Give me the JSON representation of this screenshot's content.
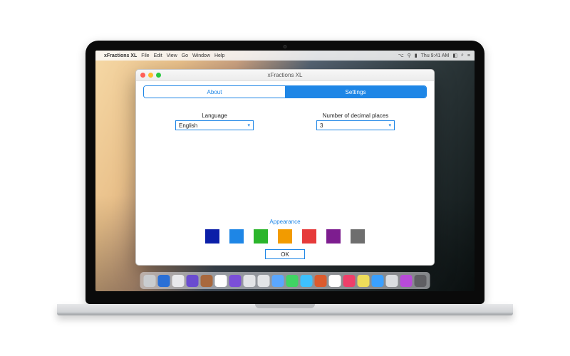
{
  "menubar": {
    "apple": "",
    "app_name": "xFractions XL",
    "items": [
      "File",
      "Edit",
      "View",
      "Go",
      "Window",
      "Help"
    ],
    "status": {
      "bt": "⌥",
      "wifi": "⚲",
      "batt": "▮",
      "time": "Thu 9:41 AM",
      "user": "◧",
      "search": "⌕",
      "menu": "≡"
    }
  },
  "window": {
    "title": "xFractions XL",
    "tabs": {
      "about": "About",
      "settings": "Settings"
    },
    "language": {
      "label": "Language",
      "value": "English"
    },
    "decimals": {
      "label": "Number of decimal places",
      "value": "3"
    },
    "appearance": {
      "label": "Appearance",
      "colors": [
        "#0b1fa8",
        "#1e86e6",
        "#2bb52b",
        "#f29b00",
        "#e63a3a",
        "#7d1d8f",
        "#6e6e6e"
      ]
    },
    "ok": "OK"
  },
  "dock": {
    "colors": [
      "#c9cccf",
      "#2a6fd6",
      "#e9e9ec",
      "#6a4cd0",
      "#a8683e",
      "#ffffff",
      "#7b4fd8",
      "#e2e4e7",
      "#e2e4e7",
      "#5aa7ff",
      "#40d463",
      "#3dc1ff",
      "#db5b2e",
      "#ffffff",
      "#ee3f6a",
      "#eedc5a",
      "#3aa0ff",
      "#dadde0",
      "#b84bd8",
      "#5f5f63"
    ]
  }
}
